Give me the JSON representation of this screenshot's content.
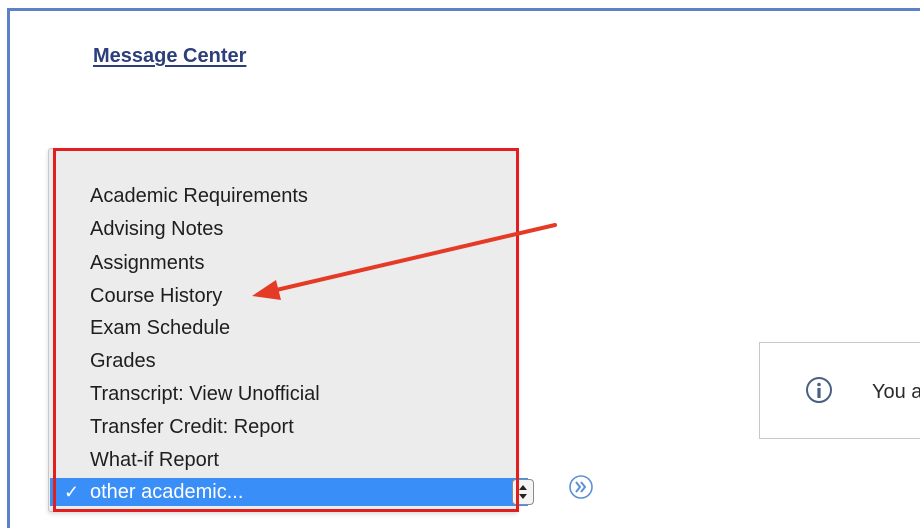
{
  "header": {
    "message_center_link": "Message Center"
  },
  "dropdown": {
    "options": [
      "Academic Requirements",
      "Advising Notes",
      "Assignments",
      "Course History",
      "Exam Schedule",
      "Grades",
      "Transcript: View Unofficial",
      "Transfer Credit: Report",
      "What-if Report"
    ],
    "selected_option": "other academic...",
    "checkmark": "✓",
    "highlight_color": "#3a8ef7"
  },
  "annotation": {
    "box_color": "#e02020",
    "arrow_color": "#e53a25",
    "arrow_target": "Course History"
  },
  "go_button": {
    "icon": "double-chevron-right-icon",
    "color": "#5b8fd6"
  },
  "info_panel": {
    "icon": "info-circle-icon",
    "text": "You a"
  }
}
